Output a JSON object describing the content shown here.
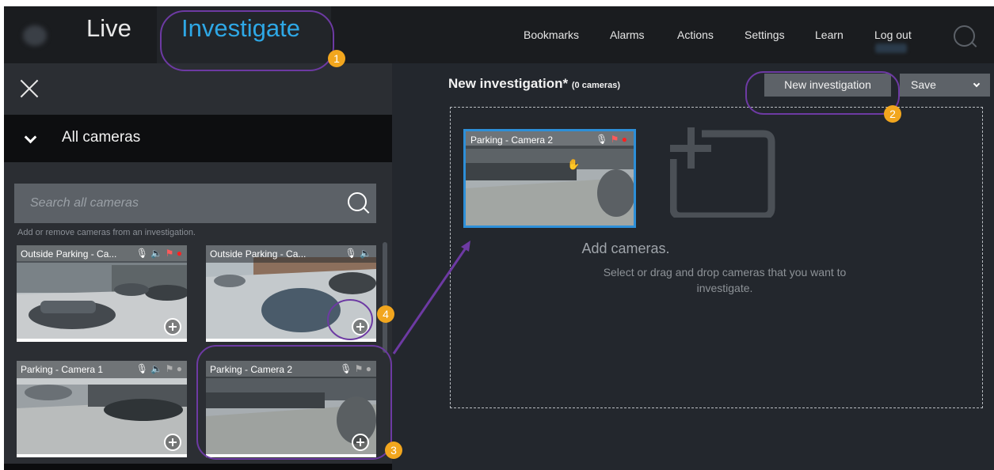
{
  "topbar": {
    "nav_live": "Live",
    "nav_investigate": "Investigate",
    "menu": [
      "Bookmarks",
      "Alarms",
      "Actions",
      "Settings",
      "Learn",
      "Log out"
    ],
    "search_icon": "search-icon"
  },
  "left_panel": {
    "close_icon": "close-icon",
    "group_label": "All cameras",
    "search_placeholder": "Search all cameras",
    "hint": "Add or remove cameras from an investigation.",
    "cameras": [
      {
        "name": "Outside Parking - Ca...",
        "icons": "🎙 🔈 ⚑ ●",
        "status_color": "#ff2020"
      },
      {
        "name": "Outside Parking - Ca...",
        "icons": "🎙 🔈"
      },
      {
        "name": "Parking - Camera 1",
        "icons": "🎙 🔈 ⚑ ●",
        "status_color": "#b0b0b0"
      },
      {
        "name": "Parking - Camera 2",
        "icons": "🎙 ⚑ ●",
        "status_color": "#b0b0b0"
      }
    ]
  },
  "main": {
    "title": "New investigation*",
    "count": "(0 cameras)",
    "new_investigation_button": "New investigation",
    "save_button": "Save",
    "dragged_camera": {
      "name": "Parking - Camera 2",
      "icons": "🎙 ⚑ ●"
    },
    "empty_title": "Add cameras.",
    "empty_subtitle": "Select or drag and drop cameras that you want to investigate."
  },
  "callouts": [
    "1",
    "2",
    "3",
    "4"
  ],
  "colors": {
    "accent": "#2ea8e6",
    "callout": "#f2a61e",
    "ring": "#6d3aa3",
    "record": "#ff2020"
  }
}
